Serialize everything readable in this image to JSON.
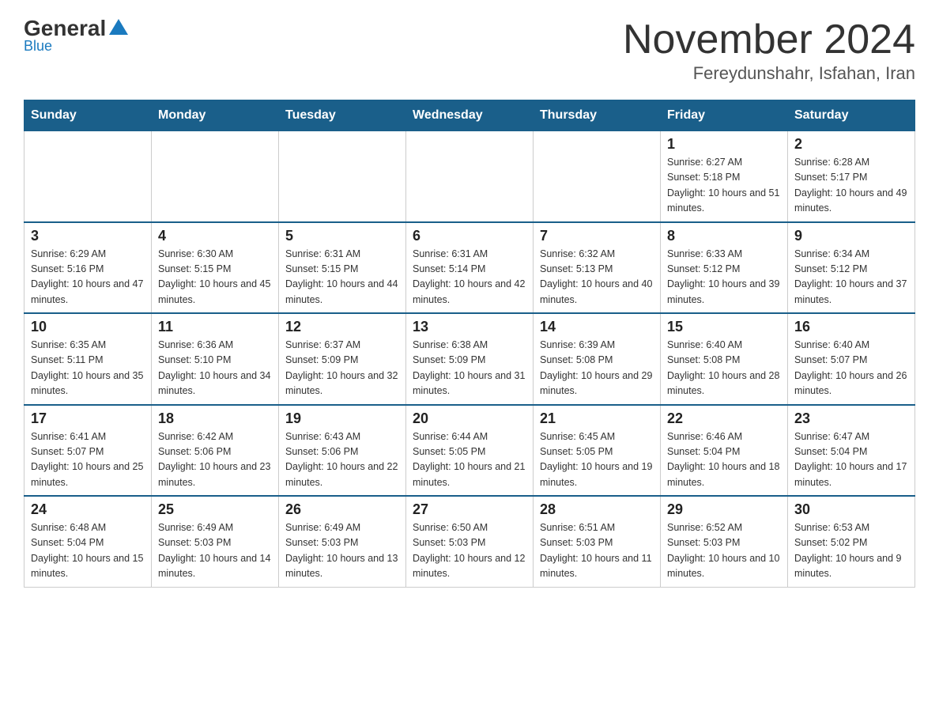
{
  "logo": {
    "general": "General",
    "blue": "Blue"
  },
  "header": {
    "month": "November 2024",
    "location": "Fereydunshahr, Isfahan, Iran"
  },
  "days": [
    "Sunday",
    "Monday",
    "Tuesday",
    "Wednesday",
    "Thursday",
    "Friday",
    "Saturday"
  ],
  "weeks": [
    [
      {
        "day": "",
        "sunrise": "",
        "sunset": "",
        "daylight": ""
      },
      {
        "day": "",
        "sunrise": "",
        "sunset": "",
        "daylight": ""
      },
      {
        "day": "",
        "sunrise": "",
        "sunset": "",
        "daylight": ""
      },
      {
        "day": "",
        "sunrise": "",
        "sunset": "",
        "daylight": ""
      },
      {
        "day": "",
        "sunrise": "",
        "sunset": "",
        "daylight": ""
      },
      {
        "day": "1",
        "sunrise": "Sunrise: 6:27 AM",
        "sunset": "Sunset: 5:18 PM",
        "daylight": "Daylight: 10 hours and 51 minutes."
      },
      {
        "day": "2",
        "sunrise": "Sunrise: 6:28 AM",
        "sunset": "Sunset: 5:17 PM",
        "daylight": "Daylight: 10 hours and 49 minutes."
      }
    ],
    [
      {
        "day": "3",
        "sunrise": "Sunrise: 6:29 AM",
        "sunset": "Sunset: 5:16 PM",
        "daylight": "Daylight: 10 hours and 47 minutes."
      },
      {
        "day": "4",
        "sunrise": "Sunrise: 6:30 AM",
        "sunset": "Sunset: 5:15 PM",
        "daylight": "Daylight: 10 hours and 45 minutes."
      },
      {
        "day": "5",
        "sunrise": "Sunrise: 6:31 AM",
        "sunset": "Sunset: 5:15 PM",
        "daylight": "Daylight: 10 hours and 44 minutes."
      },
      {
        "day": "6",
        "sunrise": "Sunrise: 6:31 AM",
        "sunset": "Sunset: 5:14 PM",
        "daylight": "Daylight: 10 hours and 42 minutes."
      },
      {
        "day": "7",
        "sunrise": "Sunrise: 6:32 AM",
        "sunset": "Sunset: 5:13 PM",
        "daylight": "Daylight: 10 hours and 40 minutes."
      },
      {
        "day": "8",
        "sunrise": "Sunrise: 6:33 AM",
        "sunset": "Sunset: 5:12 PM",
        "daylight": "Daylight: 10 hours and 39 minutes."
      },
      {
        "day": "9",
        "sunrise": "Sunrise: 6:34 AM",
        "sunset": "Sunset: 5:12 PM",
        "daylight": "Daylight: 10 hours and 37 minutes."
      }
    ],
    [
      {
        "day": "10",
        "sunrise": "Sunrise: 6:35 AM",
        "sunset": "Sunset: 5:11 PM",
        "daylight": "Daylight: 10 hours and 35 minutes."
      },
      {
        "day": "11",
        "sunrise": "Sunrise: 6:36 AM",
        "sunset": "Sunset: 5:10 PM",
        "daylight": "Daylight: 10 hours and 34 minutes."
      },
      {
        "day": "12",
        "sunrise": "Sunrise: 6:37 AM",
        "sunset": "Sunset: 5:09 PM",
        "daylight": "Daylight: 10 hours and 32 minutes."
      },
      {
        "day": "13",
        "sunrise": "Sunrise: 6:38 AM",
        "sunset": "Sunset: 5:09 PM",
        "daylight": "Daylight: 10 hours and 31 minutes."
      },
      {
        "day": "14",
        "sunrise": "Sunrise: 6:39 AM",
        "sunset": "Sunset: 5:08 PM",
        "daylight": "Daylight: 10 hours and 29 minutes."
      },
      {
        "day": "15",
        "sunrise": "Sunrise: 6:40 AM",
        "sunset": "Sunset: 5:08 PM",
        "daylight": "Daylight: 10 hours and 28 minutes."
      },
      {
        "day": "16",
        "sunrise": "Sunrise: 6:40 AM",
        "sunset": "Sunset: 5:07 PM",
        "daylight": "Daylight: 10 hours and 26 minutes."
      }
    ],
    [
      {
        "day": "17",
        "sunrise": "Sunrise: 6:41 AM",
        "sunset": "Sunset: 5:07 PM",
        "daylight": "Daylight: 10 hours and 25 minutes."
      },
      {
        "day": "18",
        "sunrise": "Sunrise: 6:42 AM",
        "sunset": "Sunset: 5:06 PM",
        "daylight": "Daylight: 10 hours and 23 minutes."
      },
      {
        "day": "19",
        "sunrise": "Sunrise: 6:43 AM",
        "sunset": "Sunset: 5:06 PM",
        "daylight": "Daylight: 10 hours and 22 minutes."
      },
      {
        "day": "20",
        "sunrise": "Sunrise: 6:44 AM",
        "sunset": "Sunset: 5:05 PM",
        "daylight": "Daylight: 10 hours and 21 minutes."
      },
      {
        "day": "21",
        "sunrise": "Sunrise: 6:45 AM",
        "sunset": "Sunset: 5:05 PM",
        "daylight": "Daylight: 10 hours and 19 minutes."
      },
      {
        "day": "22",
        "sunrise": "Sunrise: 6:46 AM",
        "sunset": "Sunset: 5:04 PM",
        "daylight": "Daylight: 10 hours and 18 minutes."
      },
      {
        "day": "23",
        "sunrise": "Sunrise: 6:47 AM",
        "sunset": "Sunset: 5:04 PM",
        "daylight": "Daylight: 10 hours and 17 minutes."
      }
    ],
    [
      {
        "day": "24",
        "sunrise": "Sunrise: 6:48 AM",
        "sunset": "Sunset: 5:04 PM",
        "daylight": "Daylight: 10 hours and 15 minutes."
      },
      {
        "day": "25",
        "sunrise": "Sunrise: 6:49 AM",
        "sunset": "Sunset: 5:03 PM",
        "daylight": "Daylight: 10 hours and 14 minutes."
      },
      {
        "day": "26",
        "sunrise": "Sunrise: 6:49 AM",
        "sunset": "Sunset: 5:03 PM",
        "daylight": "Daylight: 10 hours and 13 minutes."
      },
      {
        "day": "27",
        "sunrise": "Sunrise: 6:50 AM",
        "sunset": "Sunset: 5:03 PM",
        "daylight": "Daylight: 10 hours and 12 minutes."
      },
      {
        "day": "28",
        "sunrise": "Sunrise: 6:51 AM",
        "sunset": "Sunset: 5:03 PM",
        "daylight": "Daylight: 10 hours and 11 minutes."
      },
      {
        "day": "29",
        "sunrise": "Sunrise: 6:52 AM",
        "sunset": "Sunset: 5:03 PM",
        "daylight": "Daylight: 10 hours and 10 minutes."
      },
      {
        "day": "30",
        "sunrise": "Sunrise: 6:53 AM",
        "sunset": "Sunset: 5:02 PM",
        "daylight": "Daylight: 10 hours and 9 minutes."
      }
    ]
  ]
}
